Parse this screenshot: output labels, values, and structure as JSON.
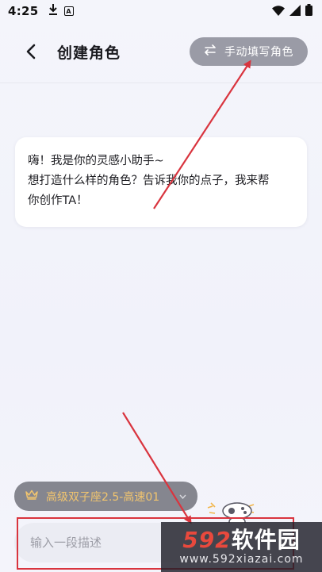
{
  "status_bar": {
    "time": "4:25",
    "left_icons": [
      "download-icon",
      "a-box-icon"
    ],
    "right_icons": [
      "wifi-icon",
      "signal-icon",
      "battery-icon"
    ]
  },
  "header": {
    "title": "创建角色",
    "manual_button_label": "手动填写角色",
    "back_icon": "chevron-left-icon",
    "swap_icon": "swap-arrows-icon"
  },
  "chat": {
    "greeting_lines": [
      "嗨！我是你的灵感小助手~",
      "想打造什么样的角色？告诉我你的点子，我来帮",
      "你创作TA！"
    ]
  },
  "model_selector": {
    "label": "高级双子座2.5-高速01",
    "icon": "crown-icon",
    "chevron": "chevron-down-icon"
  },
  "composer": {
    "placeholder": "输入一段描述"
  },
  "watermark": {
    "main_num": "592",
    "main_cn": "软件园",
    "sub": "www.592xiazai.com"
  },
  "colors": {
    "annotation_red": "#d9343e",
    "model_accent": "#f2c56e",
    "manual_button_bg": "#9a9ba6"
  }
}
